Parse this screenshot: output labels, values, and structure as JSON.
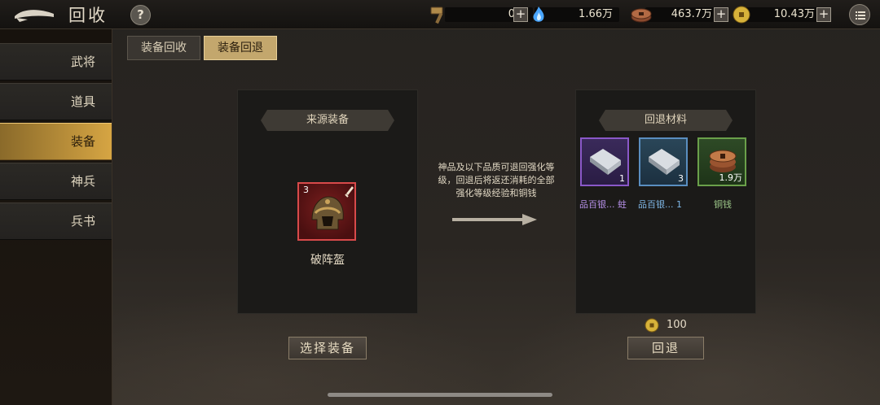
{
  "header": {
    "title": "回收",
    "help": "?",
    "resources": [
      {
        "icon": "hammer-icon",
        "value": "0"
      },
      {
        "icon": "blue-flame-icon",
        "value": "1.66万"
      },
      {
        "icon": "copper-coins-icon",
        "value": "463.7万"
      },
      {
        "icon": "gold-coin-icon",
        "value": "10.43万"
      }
    ],
    "plus": "+"
  },
  "sidebar": {
    "items": [
      {
        "label": "武将"
      },
      {
        "label": "道具"
      },
      {
        "label": "装备"
      },
      {
        "label": "神兵"
      },
      {
        "label": "兵书"
      }
    ],
    "active_index": 2
  },
  "tabs": [
    {
      "label": "装备回收"
    },
    {
      "label": "装备回退"
    }
  ],
  "active_tab": 1,
  "source_panel": {
    "title": "来源装备",
    "item": {
      "name": "破阵盔",
      "level": "3",
      "icon": "helmet-icon"
    }
  },
  "description": "神品及以下品质可退回强化等级，回退后将返还消耗的全部强化等级经验和铜钱",
  "result_panel": {
    "title": "回退材料",
    "materials": [
      {
        "icon": "silver-ingot-purple-icon",
        "count": "1",
        "label": "品百银... 蛀",
        "color": "#b690e8"
      },
      {
        "icon": "silver-ingot-blue-icon",
        "count": "3",
        "label": "品百银... 1",
        "color": "#7fb7e6"
      },
      {
        "icon": "copper-coins-icon",
        "count": "1.9万",
        "label": "铜钱",
        "color": "#9ec98a"
      }
    ]
  },
  "cost": {
    "icon": "gold-coin-icon",
    "value": "100"
  },
  "buttons": {
    "select": "选择装备",
    "revert": "回退"
  },
  "colors": {
    "accent": "#d6a543",
    "rare_red": "#d84a4a",
    "panel": "#1b1a18"
  }
}
